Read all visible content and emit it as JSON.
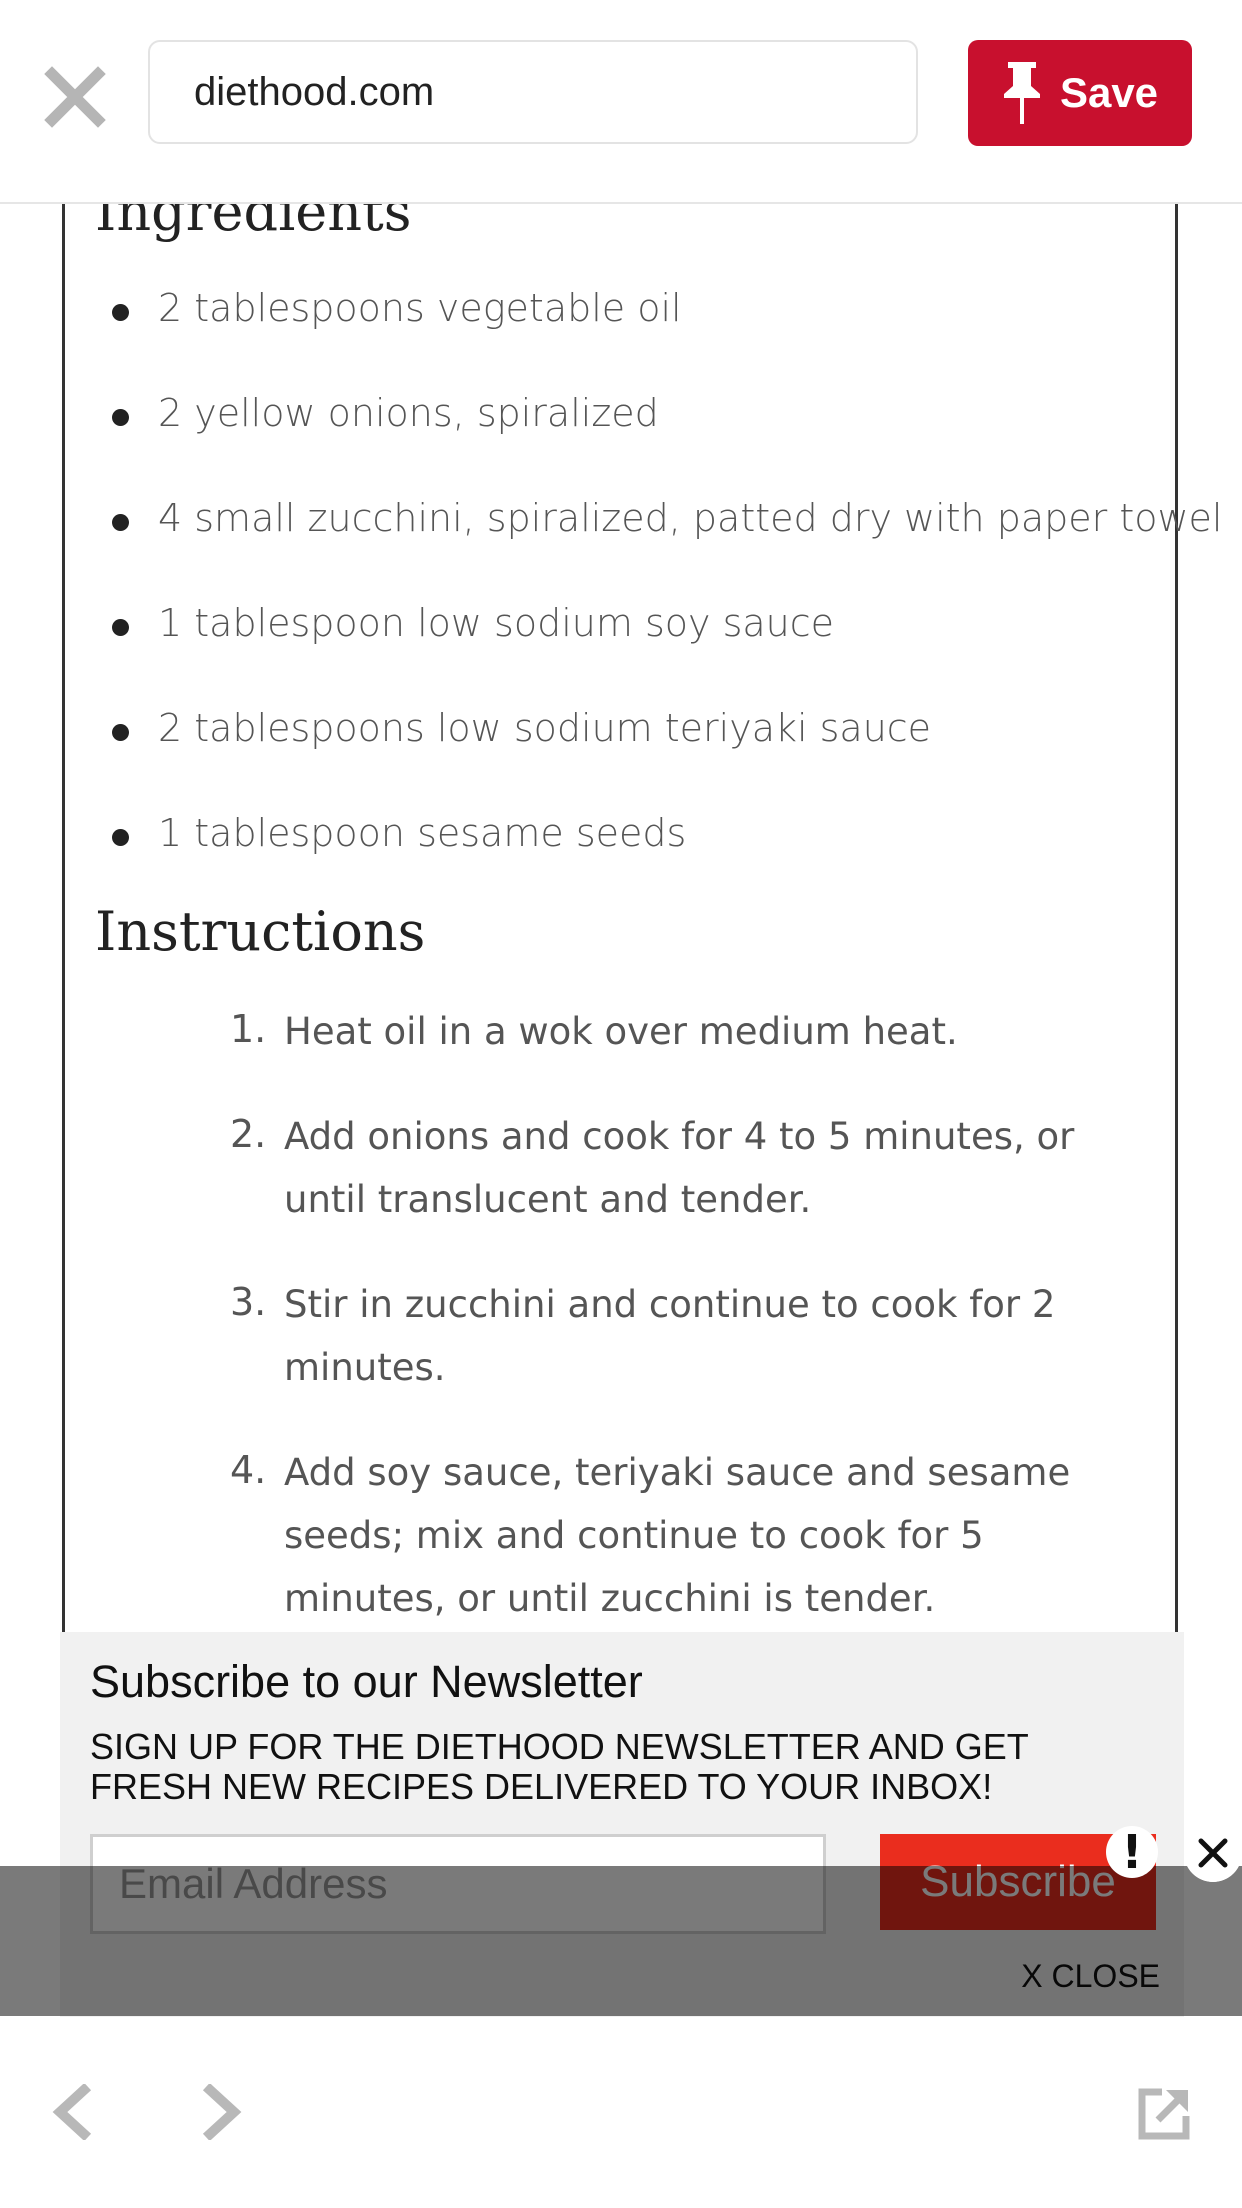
{
  "topbar": {
    "url": "diethood.com",
    "save_label": "Save"
  },
  "ingredients": {
    "heading": "Ingredients",
    "items": [
      "2 tablespoons vegetable oil",
      "2 yellow onions, spiralized",
      "4 small zucchini, spiralized, patted dry with paper towel",
      "1 tablespoon low sodium soy sauce",
      "2 tablespoons low sodium teriyaki sauce",
      "1 tablespoon sesame seeds"
    ]
  },
  "instructions": {
    "heading": "Instructions",
    "steps": [
      {
        "num": "1.",
        "text": "Heat oil in a wok over medium heat."
      },
      {
        "num": "2.",
        "text": "Add onions and cook for 4 to 5 minutes, or until translucent and tender."
      },
      {
        "num": "3.",
        "text": "Stir in zucchini and continue to cook for 2 minutes."
      },
      {
        "num": "4.",
        "text": "Add soy sauce, teriyaki sauce and sesame seeds; mix and continue to cook for 5 minutes, or until zucchini is tender."
      }
    ]
  },
  "newsletter": {
    "title": "Subscribe to our Newsletter",
    "subtitle": "SIGN UP FOR THE DIETHOOD NEWSLETTER AND GET FRESH NEW RECIPES DELIVERED TO YOUR INBOX!",
    "email_placeholder": "Email Address",
    "subscribe_label": "Subscribe",
    "close_label": "X CLOSE",
    "alert_mark": "!"
  },
  "icons": {
    "close": "close-icon",
    "pin": "pin-icon",
    "back": "chevron-left-icon",
    "forward": "chevron-right-icon",
    "external": "open-external-icon",
    "alert": "alert-icon",
    "dismiss": "close-circle-icon"
  },
  "colors": {
    "brand_red": "#c8102e",
    "subscribe_red": "#ea2d1e",
    "text": "#555555"
  }
}
